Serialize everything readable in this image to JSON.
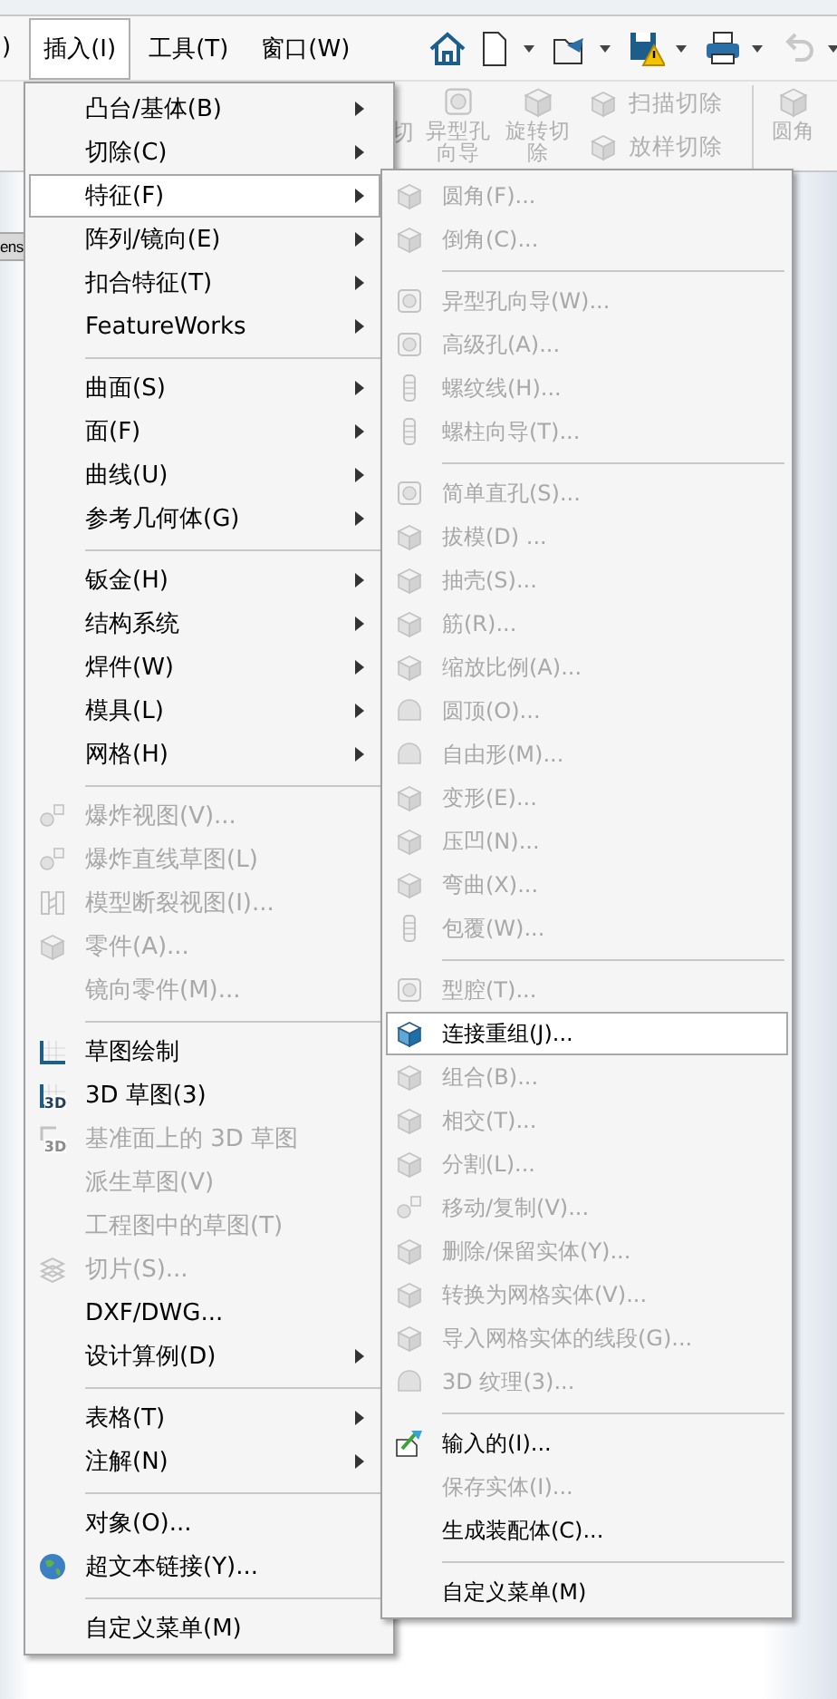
{
  "menu_bar": {
    "items": [
      {
        "label": ")",
        "selected": false
      },
      {
        "label": "插入(I)",
        "selected": true
      },
      {
        "label": "工具(T)",
        "selected": false
      },
      {
        "label": "窗口(W)",
        "selected": false
      }
    ]
  },
  "toolbar": [
    {
      "kind": "home",
      "dropdown": false,
      "disabled": false
    },
    {
      "kind": "new",
      "dropdown": true,
      "disabled": false
    },
    {
      "kind": "open",
      "dropdown": true,
      "disabled": false
    },
    {
      "kind": "save",
      "dropdown": true,
      "disabled": false
    },
    {
      "kind": "print",
      "dropdown": true,
      "disabled": false
    },
    {
      "kind": "undo",
      "dropdown": true,
      "disabled": true
    }
  ],
  "ribbon": {
    "items": [
      {
        "kind": "text",
        "label": "切",
        "disabled": true
      },
      {
        "kind": "large",
        "label": "异型孔向导",
        "disabled": true
      },
      {
        "kind": "large",
        "label": "旋转切除",
        "disabled": true
      },
      {
        "kind": "stack",
        "items": [
          {
            "label": "扫描切除",
            "disabled": true
          },
          {
            "label": "放样切除",
            "disabled": true
          }
        ]
      },
      {
        "kind": "large",
        "label": "圆角",
        "disabled": true
      }
    ]
  },
  "side_tab": {
    "label": "ens"
  },
  "insert_menu": {
    "items": [
      {
        "kind": "item",
        "label": "凸台/基体(B)",
        "submenu": true,
        "disabled": false,
        "selected": false
      },
      {
        "kind": "item",
        "label": "切除(C)",
        "submenu": true,
        "disabled": false,
        "selected": false
      },
      {
        "kind": "item",
        "label": "特征(F)",
        "submenu": true,
        "disabled": false,
        "selected": true
      },
      {
        "kind": "item",
        "label": "阵列/镜向(E)",
        "submenu": true,
        "disabled": false,
        "selected": false
      },
      {
        "kind": "item",
        "label": "扣合特征(T)",
        "submenu": true,
        "disabled": false,
        "selected": false
      },
      {
        "kind": "item",
        "label": "FeatureWorks",
        "submenu": true,
        "disabled": false,
        "selected": false
      },
      {
        "kind": "separator"
      },
      {
        "kind": "item",
        "label": "曲面(S)",
        "submenu": true,
        "disabled": false,
        "selected": false
      },
      {
        "kind": "item",
        "label": "面(F)",
        "submenu": true,
        "disabled": false,
        "selected": false
      },
      {
        "kind": "item",
        "label": "曲线(U)",
        "submenu": true,
        "disabled": false,
        "selected": false
      },
      {
        "kind": "item",
        "label": "参考几何体(G)",
        "submenu": true,
        "disabled": false,
        "selected": false
      },
      {
        "kind": "separator"
      },
      {
        "kind": "item",
        "label": "钣金(H)",
        "submenu": true,
        "disabled": false,
        "selected": false
      },
      {
        "kind": "item",
        "label": "结构系统",
        "submenu": true,
        "disabled": false,
        "selected": false
      },
      {
        "kind": "item",
        "label": "焊件(W)",
        "submenu": true,
        "disabled": false,
        "selected": false
      },
      {
        "kind": "item",
        "label": "模具(L)",
        "submenu": true,
        "disabled": false,
        "selected": false
      },
      {
        "kind": "item",
        "label": "网格(H)",
        "submenu": true,
        "disabled": false,
        "selected": false
      },
      {
        "kind": "separator"
      },
      {
        "kind": "item",
        "label": "爆炸视图(V)...",
        "submenu": false,
        "disabled": true,
        "selected": false
      },
      {
        "kind": "item",
        "label": "爆炸直线草图(L)",
        "submenu": false,
        "disabled": true,
        "selected": false
      },
      {
        "kind": "item",
        "label": "模型断裂视图(I)...",
        "submenu": false,
        "disabled": true,
        "selected": false
      },
      {
        "kind": "item",
        "label": "零件(A)...",
        "submenu": false,
        "disabled": true,
        "selected": false
      },
      {
        "kind": "item",
        "label": "镜向零件(M)...",
        "submenu": false,
        "disabled": true,
        "selected": false
      },
      {
        "kind": "separator"
      },
      {
        "kind": "item",
        "label": "草图绘制",
        "submenu": false,
        "disabled": false,
        "selected": false
      },
      {
        "kind": "item",
        "label": "3D 草图(3)",
        "badge": "3D",
        "submenu": false,
        "disabled": false,
        "selected": false
      },
      {
        "kind": "item",
        "label": "基准面上的 3D 草图",
        "badge": "3D",
        "submenu": false,
        "disabled": true,
        "selected": false
      },
      {
        "kind": "item",
        "label": "派生草图(V)",
        "submenu": false,
        "disabled": true,
        "selected": false
      },
      {
        "kind": "item",
        "label": "工程图中的草图(T)",
        "submenu": false,
        "disabled": true,
        "selected": false
      },
      {
        "kind": "item",
        "label": "切片(S)...",
        "submenu": false,
        "disabled": true,
        "selected": false
      },
      {
        "kind": "item",
        "label": "DXF/DWG...",
        "submenu": false,
        "disabled": false,
        "selected": false
      },
      {
        "kind": "item",
        "label": "设计算例(D)",
        "submenu": true,
        "disabled": false,
        "selected": false
      },
      {
        "kind": "separator"
      },
      {
        "kind": "item",
        "label": "表格(T)",
        "submenu": true,
        "disabled": false,
        "selected": false
      },
      {
        "kind": "item",
        "label": "注解(N)",
        "submenu": true,
        "disabled": false,
        "selected": false
      },
      {
        "kind": "separator"
      },
      {
        "kind": "item",
        "label": "对象(O)...",
        "submenu": false,
        "disabled": false,
        "selected": false
      },
      {
        "kind": "item",
        "label": "超文本链接(Y)...",
        "submenu": false,
        "disabled": false,
        "selected": false
      },
      {
        "kind": "separator"
      },
      {
        "kind": "item",
        "label": "自定义菜单(M)",
        "submenu": false,
        "disabled": false,
        "selected": false
      }
    ]
  },
  "features_submenu": {
    "items": [
      {
        "kind": "item",
        "label": "圆角(F)...",
        "disabled": true,
        "selected": false
      },
      {
        "kind": "item",
        "label": "倒角(C)...",
        "disabled": true,
        "selected": false
      },
      {
        "kind": "separator"
      },
      {
        "kind": "item",
        "label": "异型孔向导(W)...",
        "disabled": true,
        "selected": false
      },
      {
        "kind": "item",
        "label": "高级孔(A)...",
        "disabled": true,
        "selected": false
      },
      {
        "kind": "item",
        "label": "螺纹线(H)...",
        "disabled": true,
        "selected": false
      },
      {
        "kind": "item",
        "label": "螺柱向导(T)...",
        "disabled": true,
        "selected": false
      },
      {
        "kind": "separator"
      },
      {
        "kind": "item",
        "label": "简单直孔(S)...",
        "disabled": true,
        "selected": false
      },
      {
        "kind": "item",
        "label": "拔模(D) ...",
        "disabled": true,
        "selected": false
      },
      {
        "kind": "item",
        "label": "抽壳(S)...",
        "disabled": true,
        "selected": false
      },
      {
        "kind": "item",
        "label": "筋(R)...",
        "disabled": true,
        "selected": false
      },
      {
        "kind": "item",
        "label": "缩放比例(A)...",
        "disabled": true,
        "selected": false
      },
      {
        "kind": "item",
        "label": "圆顶(O)...",
        "disabled": true,
        "selected": false
      },
      {
        "kind": "item",
        "label": "自由形(M)...",
        "disabled": true,
        "selected": false
      },
      {
        "kind": "item",
        "label": "变形(E)...",
        "disabled": true,
        "selected": false
      },
      {
        "kind": "item",
        "label": "压凹(N)...",
        "disabled": true,
        "selected": false
      },
      {
        "kind": "item",
        "label": "弯曲(X)...",
        "disabled": true,
        "selected": false
      },
      {
        "kind": "item",
        "label": "包覆(W)...",
        "disabled": true,
        "selected": false
      },
      {
        "kind": "separator"
      },
      {
        "kind": "item",
        "label": "型腔(T)...",
        "disabled": true,
        "selected": false
      },
      {
        "kind": "item",
        "label": "连接重组(J)...",
        "disabled": false,
        "selected": true
      },
      {
        "kind": "item",
        "label": "组合(B)...",
        "disabled": true,
        "selected": false
      },
      {
        "kind": "item",
        "label": "相交(T)...",
        "disabled": true,
        "selected": false
      },
      {
        "kind": "item",
        "label": "分割(L)...",
        "disabled": true,
        "selected": false
      },
      {
        "kind": "item",
        "label": "移动/复制(V)...",
        "disabled": true,
        "selected": false
      },
      {
        "kind": "item",
        "label": "删除/保留实体(Y)...",
        "disabled": true,
        "selected": false
      },
      {
        "kind": "item",
        "label": "转换为网格实体(V)...",
        "disabled": true,
        "selected": false
      },
      {
        "kind": "item",
        "label": "导入网格实体的线段(G)...",
        "disabled": true,
        "selected": false
      },
      {
        "kind": "item",
        "label": "3D 纹理(3)...",
        "disabled": true,
        "selected": false
      },
      {
        "kind": "separator"
      },
      {
        "kind": "item",
        "label": "输入的(I)...",
        "disabled": false,
        "selected": false
      },
      {
        "kind": "item",
        "label": "保存实体(I)...",
        "disabled": true,
        "selected": false
      },
      {
        "kind": "item",
        "label": "生成装配体(C)...",
        "disabled": false,
        "selected": false
      },
      {
        "kind": "separator"
      },
      {
        "kind": "item",
        "label": "自定义菜单(M)",
        "disabled": false,
        "selected": false
      }
    ]
  }
}
